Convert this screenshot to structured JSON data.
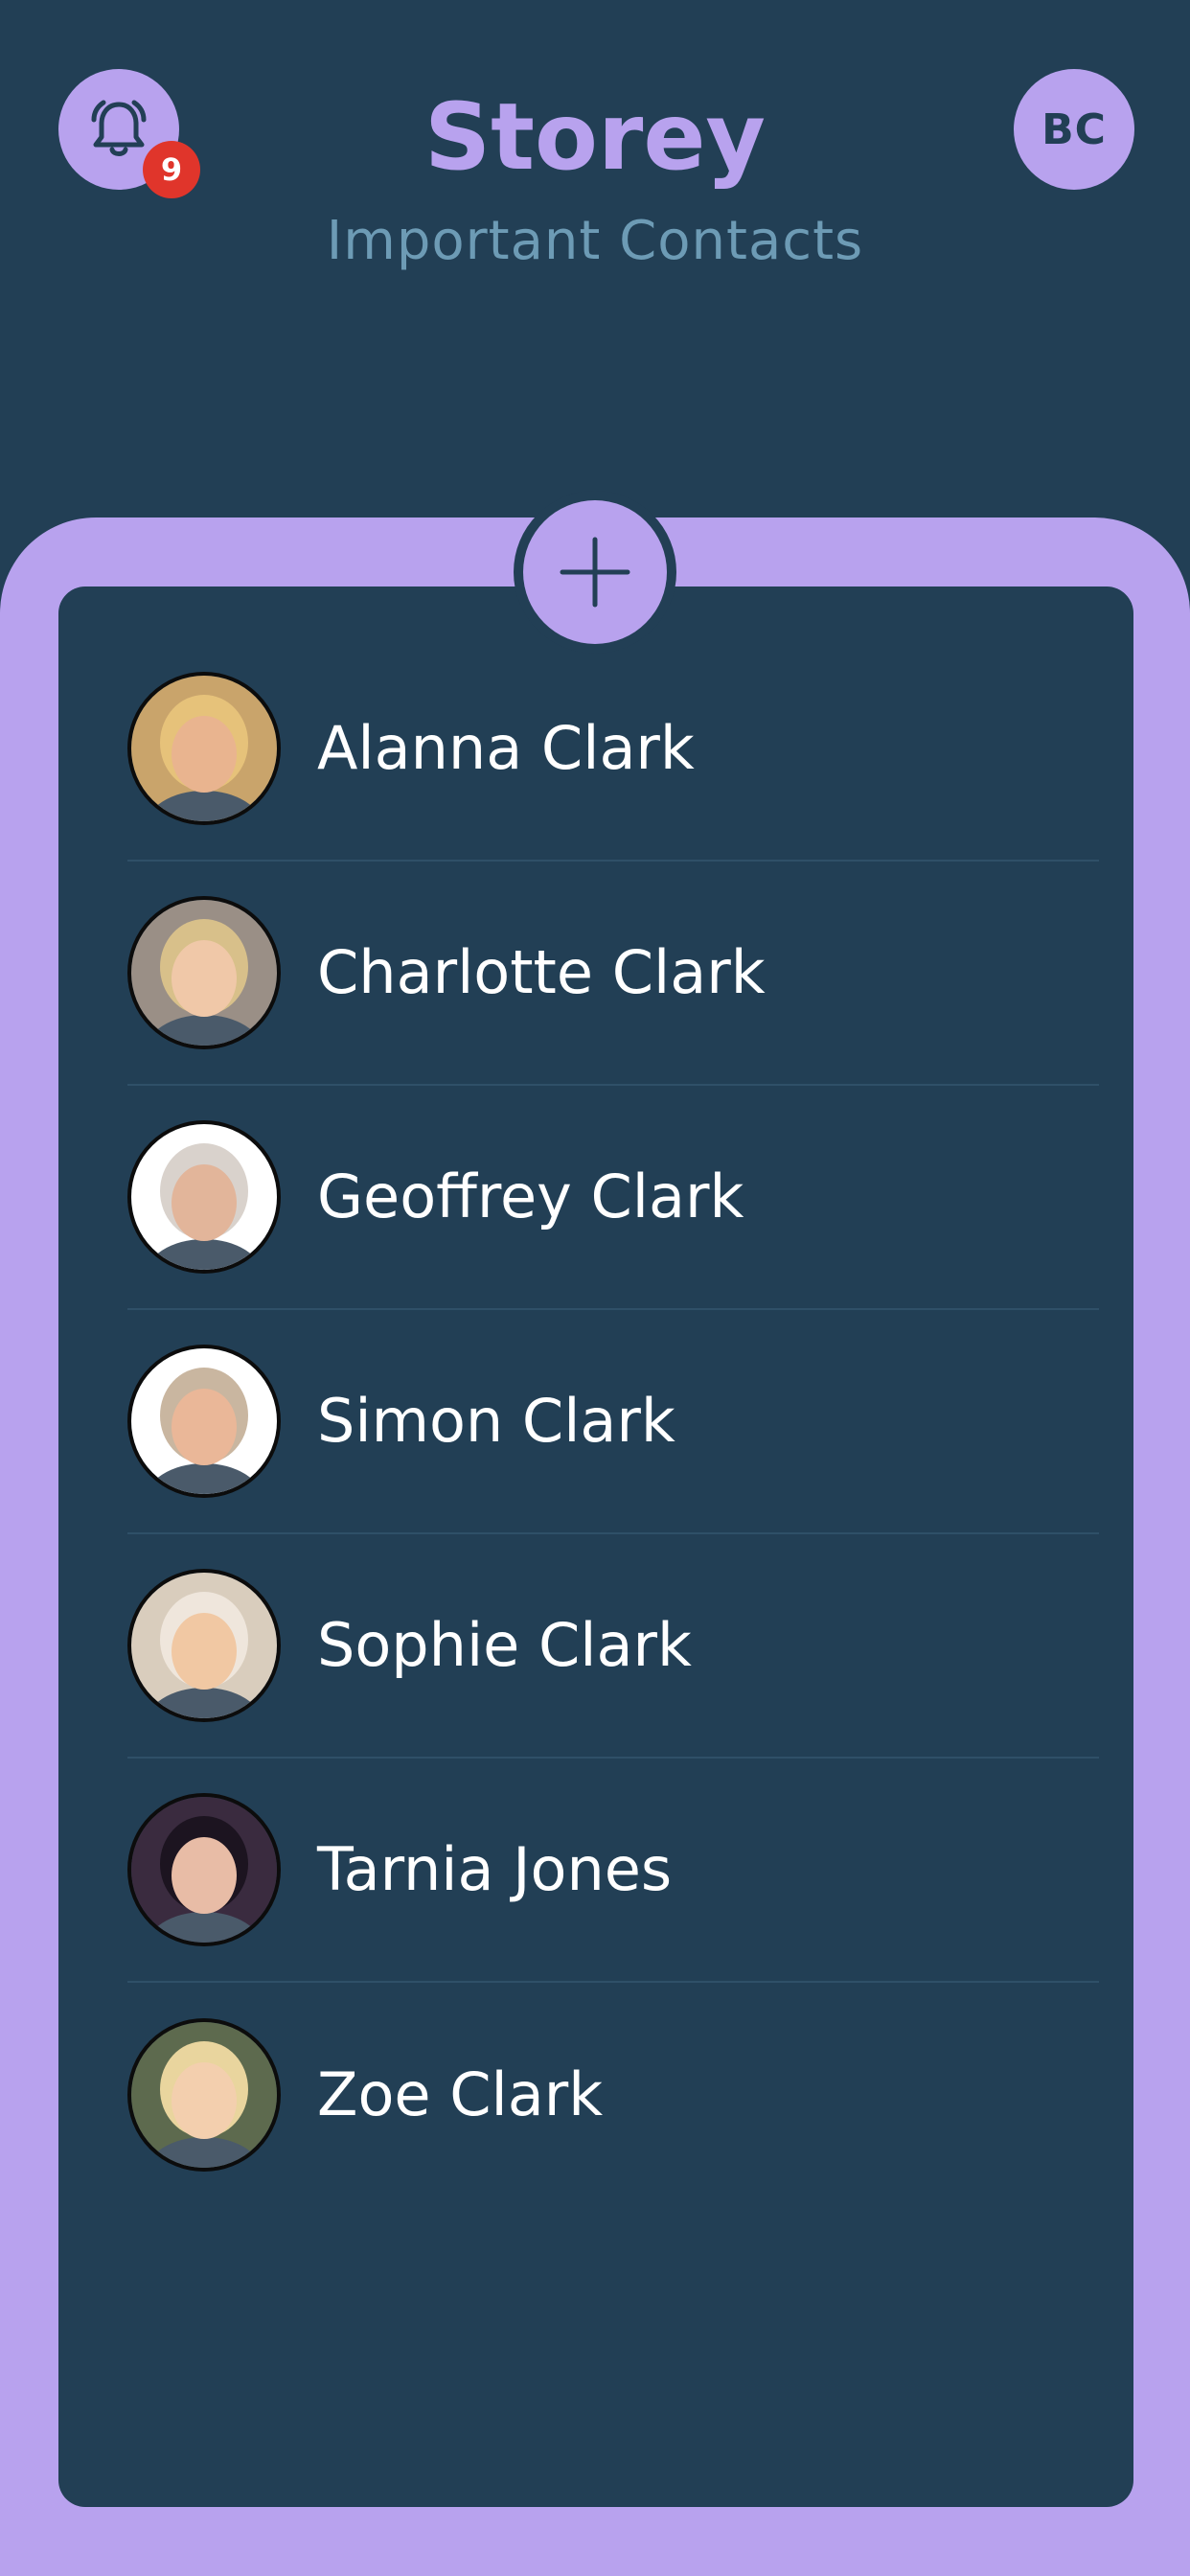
{
  "header": {
    "title": "Storey",
    "subtitle": "Important Contacts",
    "notification_count": "9",
    "user_initials": "BC"
  },
  "colors": {
    "background": "#223f55",
    "accent": "#b8a2ee",
    "subtitle": "#6d9bb5",
    "badge": "#e0352b"
  },
  "contacts": [
    {
      "name": "Alanna Clark",
      "avatar_bg": "#c9a46b",
      "hair": "#e6c27a",
      "skin": "#e9b48f"
    },
    {
      "name": "Charlotte Clark",
      "avatar_bg": "#9a8f86",
      "hair": "#d8c08a",
      "skin": "#f0c8a8"
    },
    {
      "name": "Geoffrey Clark",
      "avatar_bg": "#ffffff",
      "hair": "#d9d2cc",
      "skin": "#e2b59a"
    },
    {
      "name": "Simon Clark",
      "avatar_bg": "#ffffff",
      "hair": "#c9b6a0",
      "skin": "#eab798"
    },
    {
      "name": "Sophie Clark",
      "avatar_bg": "#d9cdbd",
      "hair": "#efe6dc",
      "skin": "#f1c8a3"
    },
    {
      "name": "Tarnia Jones",
      "avatar_bg": "#3a2b3f",
      "hair": "#1c1420",
      "skin": "#e8bca6"
    },
    {
      "name": "Zoe Clark",
      "avatar_bg": "#5d6a4e",
      "hair": "#e9d59e",
      "skin": "#f3cfae"
    }
  ]
}
